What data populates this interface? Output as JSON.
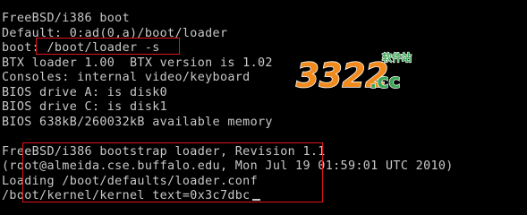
{
  "console": {
    "lines": [
      "FreeBSD/i386 boot",
      "Default: 0:ad(0,a)/boot/loader",
      "boot: /boot/loader -s",
      "BTX loader 1.00  BTX version is 1.02",
      "Consoles: internal video/keyboard",
      "BIOS drive A: is disk0",
      "BIOS drive C: is disk1",
      "BIOS 638kB/260032kB available memory",
      "",
      "FreeBSD/i386 bootstrap loader, Revision 1.1",
      "(root@almeida.cse.buffalo.edu, Mon Jul 19 01:59:01 UTC 2010)",
      "Loading /boot/defaults/loader.conf",
      "/boot/kernel/kernel text=0x3c7dbc"
    ],
    "top_fragment": "—"
  },
  "watermark": {
    "number": "3322",
    "site": "软件站",
    "domain": ".cc"
  },
  "colors": {
    "background": "#000000",
    "text": "#c8c8c8",
    "highlight": "#e0141e",
    "watermark_orange": "#f08a1c",
    "watermark_green": "#3aa655"
  }
}
